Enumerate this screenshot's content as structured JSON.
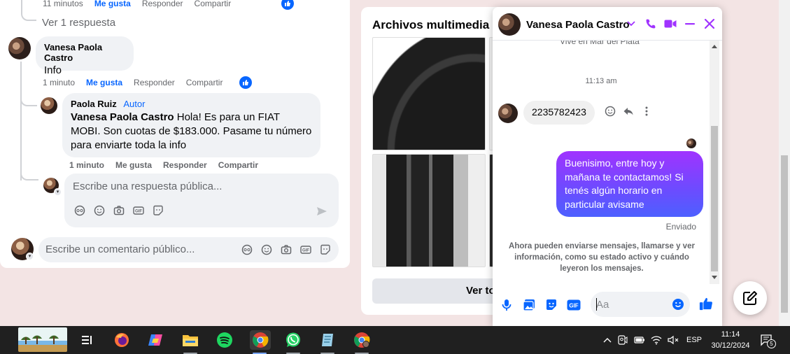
{
  "post": {
    "top_meta": {
      "time": "11 minutos",
      "like": "Me gusta",
      "reply": "Responder",
      "share": "Compartir"
    },
    "top_view_replies": "Ver 1 respuesta",
    "comment": {
      "author": "Vanesa Paola Castro",
      "text": "Info",
      "time": "1 minuto",
      "like": "Me gusta",
      "reply": "Responder",
      "share": "Compartir"
    },
    "reply": {
      "author": "Paola Ruiz",
      "author_tag": "Autor",
      "mention": "Vanesa Paola Castro",
      "text": " Hola! Es para un FIAT MOBI. Son cuotas de $183.000. Pasame tu número para enviarte toda la info",
      "time": "1 minuto",
      "like": "Me gusta",
      "reply": "Responder",
      "share": "Compartir"
    },
    "reply_input_placeholder": "Escribe una respuesta pública...",
    "comment_input_placeholder": "Escribe un comentario público..."
  },
  "media": {
    "title": "Archivos multimedia re",
    "see_all": "Ver to"
  },
  "chat": {
    "contact_name": "Vanesa Paola Castro",
    "cut_text": "Vive en Mar del Plata",
    "timestamp": "11:13 am",
    "incoming_message": "2235782423",
    "outgoing_message": "Buenisimo, entre hoy y mañana te contactamos! Si tenés algún horario en particular avisame",
    "status": "Enviado",
    "info": "Ahora pueden enviarse mensajes, llamarse y ver información, como su estado activo y cuándo leyeron los mensajes.",
    "input_placeholder": "Aa",
    "accent_color": "#a033ff",
    "messenger_blue": "#0866ff"
  },
  "taskbar": {
    "language": "ESP",
    "time": "11:14",
    "date": "30/12/2024",
    "notifications": "5"
  }
}
